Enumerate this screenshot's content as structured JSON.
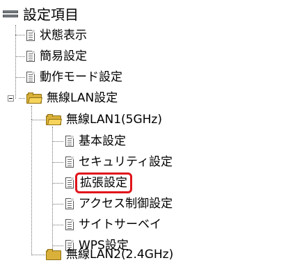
{
  "tree": {
    "root": {
      "label": "設定項目",
      "icon": "settings-tree-icon"
    },
    "items": [
      {
        "label": "状態表示",
        "icon": "document-icon"
      },
      {
        "label": "簡易設定",
        "icon": "document-icon"
      },
      {
        "label": "動作モード設定",
        "icon": "document-icon"
      },
      {
        "label": "無線LAN設定",
        "icon": "folder-open-icon",
        "expanded": true
      },
      {
        "label": "無線LAN1(5GHz)",
        "icon": "folder-open-icon",
        "expanded": true
      },
      {
        "label": "基本設定",
        "icon": "document-icon"
      },
      {
        "label": "セキュリティ設定",
        "icon": "document-icon"
      },
      {
        "label": "拡張設定",
        "icon": "document-icon",
        "highlighted": true
      },
      {
        "label": "アクセス制御設定",
        "icon": "document-icon"
      },
      {
        "label": "サイトサーベイ",
        "icon": "document-icon"
      },
      {
        "label": "WPS設定",
        "icon": "document-icon"
      },
      {
        "label": "無線LAN2(2.4GHz)",
        "icon": "folder-icon"
      }
    ]
  },
  "colors": {
    "highlight_border": "#e0141b",
    "folder": "#f6d35a",
    "tree_lines": "#6f6f6f"
  }
}
